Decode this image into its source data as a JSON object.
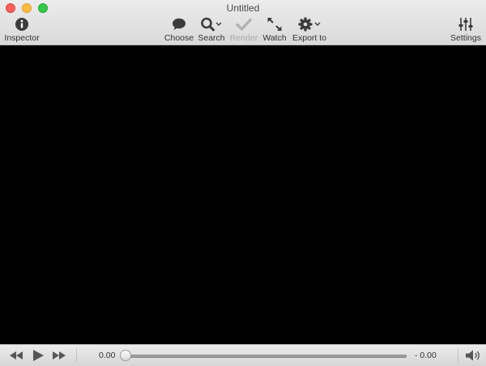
{
  "window": {
    "title": "Untitled"
  },
  "toolbar": {
    "inspector": {
      "label": "Inspector",
      "icon": "info-icon"
    },
    "choose": {
      "label": "Choose",
      "icon": "speech-bubble-icon"
    },
    "search": {
      "label": "Search",
      "icon": "magnifier-icon"
    },
    "render": {
      "label": "Render",
      "icon": "checkmark-icon",
      "disabled": true
    },
    "watch": {
      "label": "Watch",
      "icon": "fullscreen-arrows-icon"
    },
    "export": {
      "label": "Export to",
      "icon": "gear-icon"
    },
    "settings": {
      "label": "Settings",
      "icon": "sliders-icon"
    }
  },
  "transport": {
    "current_time": "0.00",
    "remaining_time": "- 0.00",
    "progress": 0
  },
  "colors": {
    "close": "#fc605c",
    "minimize": "#fdbc40",
    "maximize": "#34c84a",
    "video_bg": "#000000"
  }
}
